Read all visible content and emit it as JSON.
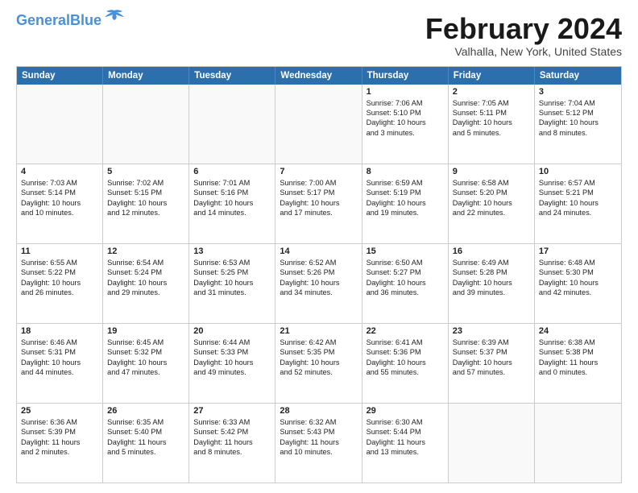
{
  "header": {
    "logo_general": "General",
    "logo_blue": "Blue",
    "month_title": "February 2024",
    "location": "Valhalla, New York, United States"
  },
  "calendar": {
    "days_of_week": [
      "Sunday",
      "Monday",
      "Tuesday",
      "Wednesday",
      "Thursday",
      "Friday",
      "Saturday"
    ],
    "rows": [
      [
        {
          "day": "",
          "empty": true
        },
        {
          "day": "",
          "empty": true
        },
        {
          "day": "",
          "empty": true
        },
        {
          "day": "",
          "empty": true
        },
        {
          "day": "1",
          "lines": [
            "Sunrise: 7:06 AM",
            "Sunset: 5:10 PM",
            "Daylight: 10 hours",
            "and 3 minutes."
          ]
        },
        {
          "day": "2",
          "lines": [
            "Sunrise: 7:05 AM",
            "Sunset: 5:11 PM",
            "Daylight: 10 hours",
            "and 5 minutes."
          ]
        },
        {
          "day": "3",
          "lines": [
            "Sunrise: 7:04 AM",
            "Sunset: 5:12 PM",
            "Daylight: 10 hours",
            "and 8 minutes."
          ]
        }
      ],
      [
        {
          "day": "4",
          "lines": [
            "Sunrise: 7:03 AM",
            "Sunset: 5:14 PM",
            "Daylight: 10 hours",
            "and 10 minutes."
          ]
        },
        {
          "day": "5",
          "lines": [
            "Sunrise: 7:02 AM",
            "Sunset: 5:15 PM",
            "Daylight: 10 hours",
            "and 12 minutes."
          ]
        },
        {
          "day": "6",
          "lines": [
            "Sunrise: 7:01 AM",
            "Sunset: 5:16 PM",
            "Daylight: 10 hours",
            "and 14 minutes."
          ]
        },
        {
          "day": "7",
          "lines": [
            "Sunrise: 7:00 AM",
            "Sunset: 5:17 PM",
            "Daylight: 10 hours",
            "and 17 minutes."
          ]
        },
        {
          "day": "8",
          "lines": [
            "Sunrise: 6:59 AM",
            "Sunset: 5:19 PM",
            "Daylight: 10 hours",
            "and 19 minutes."
          ]
        },
        {
          "day": "9",
          "lines": [
            "Sunrise: 6:58 AM",
            "Sunset: 5:20 PM",
            "Daylight: 10 hours",
            "and 22 minutes."
          ]
        },
        {
          "day": "10",
          "lines": [
            "Sunrise: 6:57 AM",
            "Sunset: 5:21 PM",
            "Daylight: 10 hours",
            "and 24 minutes."
          ]
        }
      ],
      [
        {
          "day": "11",
          "lines": [
            "Sunrise: 6:55 AM",
            "Sunset: 5:22 PM",
            "Daylight: 10 hours",
            "and 26 minutes."
          ]
        },
        {
          "day": "12",
          "lines": [
            "Sunrise: 6:54 AM",
            "Sunset: 5:24 PM",
            "Daylight: 10 hours",
            "and 29 minutes."
          ]
        },
        {
          "day": "13",
          "lines": [
            "Sunrise: 6:53 AM",
            "Sunset: 5:25 PM",
            "Daylight: 10 hours",
            "and 31 minutes."
          ]
        },
        {
          "day": "14",
          "lines": [
            "Sunrise: 6:52 AM",
            "Sunset: 5:26 PM",
            "Daylight: 10 hours",
            "and 34 minutes."
          ]
        },
        {
          "day": "15",
          "lines": [
            "Sunrise: 6:50 AM",
            "Sunset: 5:27 PM",
            "Daylight: 10 hours",
            "and 36 minutes."
          ]
        },
        {
          "day": "16",
          "lines": [
            "Sunrise: 6:49 AM",
            "Sunset: 5:28 PM",
            "Daylight: 10 hours",
            "and 39 minutes."
          ]
        },
        {
          "day": "17",
          "lines": [
            "Sunrise: 6:48 AM",
            "Sunset: 5:30 PM",
            "Daylight: 10 hours",
            "and 42 minutes."
          ]
        }
      ],
      [
        {
          "day": "18",
          "lines": [
            "Sunrise: 6:46 AM",
            "Sunset: 5:31 PM",
            "Daylight: 10 hours",
            "and 44 minutes."
          ]
        },
        {
          "day": "19",
          "lines": [
            "Sunrise: 6:45 AM",
            "Sunset: 5:32 PM",
            "Daylight: 10 hours",
            "and 47 minutes."
          ]
        },
        {
          "day": "20",
          "lines": [
            "Sunrise: 6:44 AM",
            "Sunset: 5:33 PM",
            "Daylight: 10 hours",
            "and 49 minutes."
          ]
        },
        {
          "day": "21",
          "lines": [
            "Sunrise: 6:42 AM",
            "Sunset: 5:35 PM",
            "Daylight: 10 hours",
            "and 52 minutes."
          ]
        },
        {
          "day": "22",
          "lines": [
            "Sunrise: 6:41 AM",
            "Sunset: 5:36 PM",
            "Daylight: 10 hours",
            "and 55 minutes."
          ]
        },
        {
          "day": "23",
          "lines": [
            "Sunrise: 6:39 AM",
            "Sunset: 5:37 PM",
            "Daylight: 10 hours",
            "and 57 minutes."
          ]
        },
        {
          "day": "24",
          "lines": [
            "Sunrise: 6:38 AM",
            "Sunset: 5:38 PM",
            "Daylight: 11 hours",
            "and 0 minutes."
          ]
        }
      ],
      [
        {
          "day": "25",
          "lines": [
            "Sunrise: 6:36 AM",
            "Sunset: 5:39 PM",
            "Daylight: 11 hours",
            "and 2 minutes."
          ]
        },
        {
          "day": "26",
          "lines": [
            "Sunrise: 6:35 AM",
            "Sunset: 5:40 PM",
            "Daylight: 11 hours",
            "and 5 minutes."
          ]
        },
        {
          "day": "27",
          "lines": [
            "Sunrise: 6:33 AM",
            "Sunset: 5:42 PM",
            "Daylight: 11 hours",
            "and 8 minutes."
          ]
        },
        {
          "day": "28",
          "lines": [
            "Sunrise: 6:32 AM",
            "Sunset: 5:43 PM",
            "Daylight: 11 hours",
            "and 10 minutes."
          ]
        },
        {
          "day": "29",
          "lines": [
            "Sunrise: 6:30 AM",
            "Sunset: 5:44 PM",
            "Daylight: 11 hours",
            "and 13 minutes."
          ]
        },
        {
          "day": "",
          "empty": true
        },
        {
          "day": "",
          "empty": true
        }
      ]
    ]
  }
}
